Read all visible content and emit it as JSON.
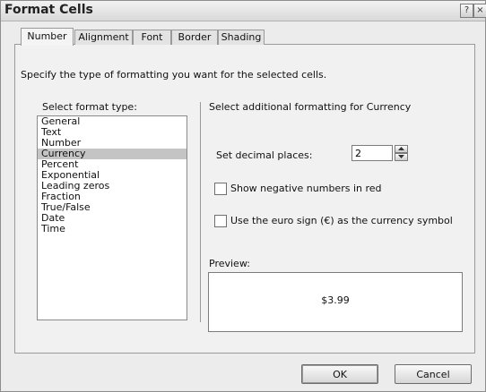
{
  "window": {
    "title": "Format Cells"
  },
  "titlebar": {
    "help_label": "?",
    "close_label": "×"
  },
  "tabs": [
    {
      "label": "Number",
      "active": true
    },
    {
      "label": "Alignment",
      "active": false
    },
    {
      "label": "Font",
      "active": false
    },
    {
      "label": "Border",
      "active": false
    },
    {
      "label": "Shading",
      "active": false
    }
  ],
  "description": "Specify the type of formatting you want for the selected cells.",
  "format_type": {
    "label": "Select format type:",
    "items": [
      "General",
      "Text",
      "Number",
      "Currency",
      "Percent",
      "Exponential",
      "Leading zeros",
      "Fraction",
      "True/False",
      "Date",
      "Time"
    ],
    "selected": "Currency"
  },
  "additional": {
    "label": "Select additional formatting for Currency",
    "decimal_label": "Set decimal places:",
    "decimal_value": "2",
    "negative_red_label": "Show negative numbers in red",
    "negative_red_checked": false,
    "euro_label": "Use the euro sign (€) as the currency symbol",
    "euro_checked": false
  },
  "preview": {
    "label": "Preview:",
    "value": "$3.99"
  },
  "buttons": {
    "ok": "OK",
    "cancel": "Cancel"
  }
}
